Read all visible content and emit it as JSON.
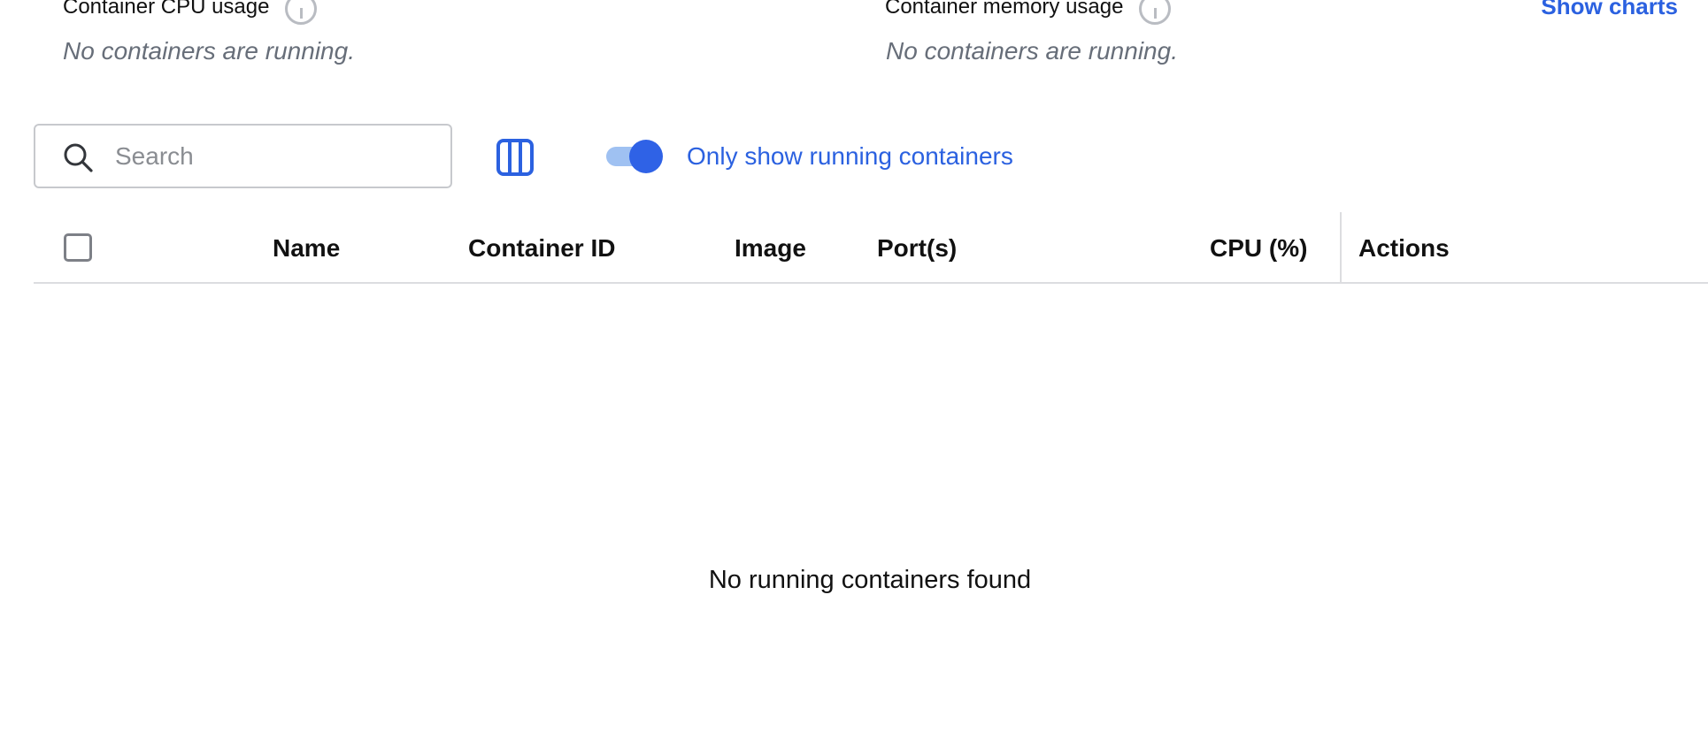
{
  "stats": {
    "cpu": {
      "title": "Container CPU usage",
      "empty": "No containers are running."
    },
    "memory": {
      "title": "Container memory usage",
      "empty": "No containers are running."
    },
    "show_charts_label": "Show charts"
  },
  "toolbar": {
    "search": {
      "placeholder": "Search",
      "value": ""
    },
    "columns_icon": "columns-icon",
    "running_toggle": {
      "label": "Only show running containers",
      "checked": true
    }
  },
  "table": {
    "columns": [
      "Name",
      "Container ID",
      "Image",
      "Port(s)",
      "CPU (%)",
      "Actions"
    ],
    "rows": [],
    "empty_message": "No running containers found"
  },
  "colors": {
    "accent": "#2b61e0",
    "toggle_track": "#9fc1f2",
    "muted_text": "#676e79"
  }
}
